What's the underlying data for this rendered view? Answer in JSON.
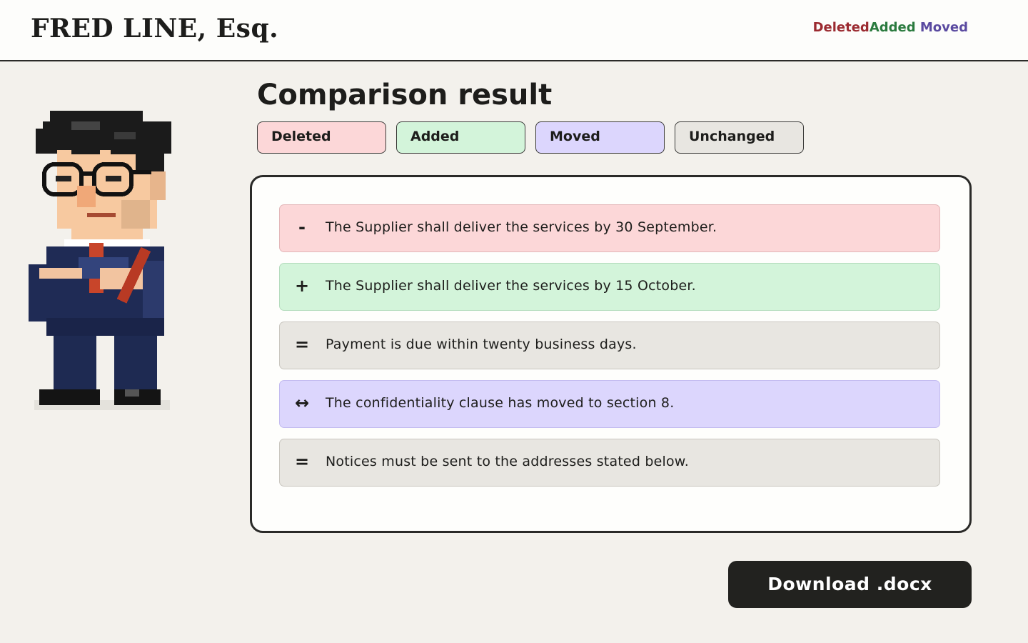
{
  "header": {
    "brand": "FRED LINE, Esq.",
    "legend": {
      "deleted": "Deleted",
      "added": "Added",
      "moved": "Moved"
    }
  },
  "main": {
    "title": "Comparison result",
    "filters": {
      "deleted": "Deleted",
      "added": "Added",
      "moved": "Moved",
      "unchanged": "Unchanged"
    },
    "rows": [
      {
        "type": "deleted",
        "symbol": "-",
        "text": "The Supplier shall deliver the services by 30 September."
      },
      {
        "type": "added",
        "symbol": "+",
        "text": "The Supplier shall deliver the services by 15 October."
      },
      {
        "type": "unchanged",
        "symbol": "=",
        "text": "Payment is due within twenty business days."
      },
      {
        "type": "moved",
        "symbol": "↔",
        "text": "The confidentiality clause has moved to section 8."
      },
      {
        "type": "unchanged",
        "symbol": "=",
        "text": "Notices must be sent to the addresses stated below."
      }
    ],
    "download_label": "Download .docx"
  },
  "colors": {
    "deleted_bg": "#fcd7d8",
    "added_bg": "#d3f4da",
    "moved_bg": "#dcd6fd",
    "unchanged_bg": "#e8e6e1",
    "deleted_text": "#9b2a30",
    "added_text": "#2a7a3e",
    "moved_text": "#5a4aa0"
  },
  "avatar_icon": "pixel-lawyer-avatar"
}
